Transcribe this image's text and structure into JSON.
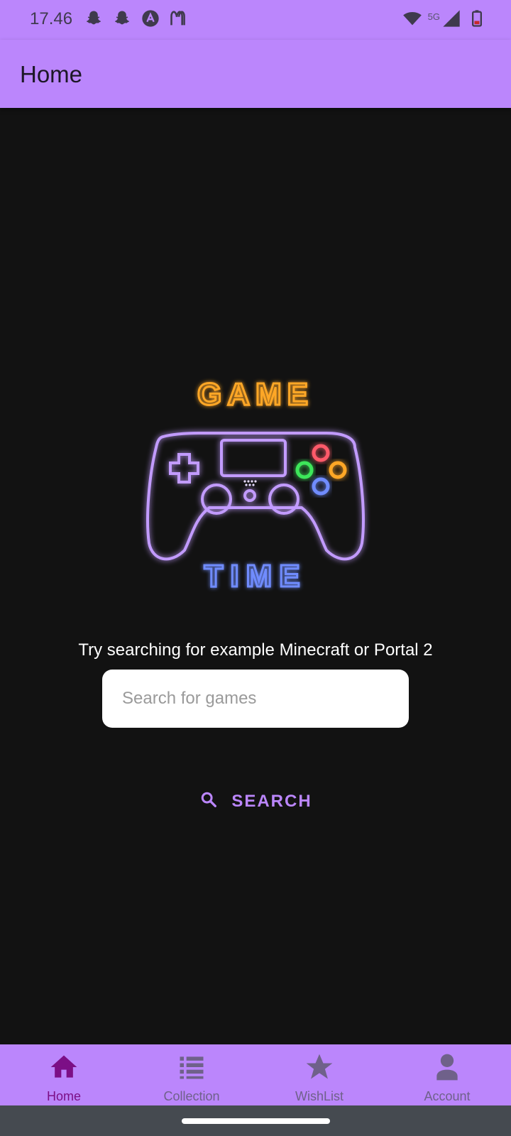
{
  "status_bar": {
    "time": "17.46",
    "network": "5G",
    "left_icons": [
      "snapchat-icon",
      "snapchat-icon",
      "app-icon",
      "mcdonalds-icon"
    ],
    "right_icons": [
      "wifi-icon",
      "signal-icon",
      "battery-icon"
    ]
  },
  "app_bar": {
    "title": "Home"
  },
  "logo": {
    "top_word": "GAME",
    "bottom_word": "TIME",
    "top_color": "#ffa726",
    "bottom_color": "#6f8cff",
    "controller_color": "#c29bff"
  },
  "main": {
    "hint": "Try searching for example Minecraft or Portal 2",
    "search_placeholder": "Search for games",
    "search_value": "",
    "search_button_label": "SEARCH"
  },
  "bottom_nav": {
    "items": [
      {
        "label": "Home",
        "icon": "home-icon",
        "active": true
      },
      {
        "label": "Collection",
        "icon": "list-icon",
        "active": false
      },
      {
        "label": "WishList",
        "icon": "star-icon",
        "active": false
      },
      {
        "label": "Account",
        "icon": "account-icon",
        "active": false
      }
    ]
  },
  "colors": {
    "accent": "#bb86fc",
    "background": "#121212",
    "active_nav": "#7c0f86",
    "inactive_nav": "#6f618a"
  }
}
